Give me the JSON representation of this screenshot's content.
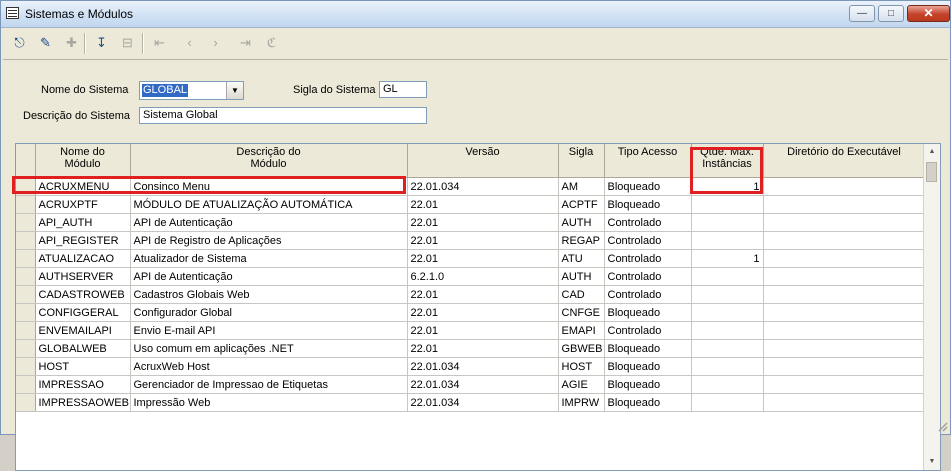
{
  "window": {
    "title": "Sistemas e Módulos"
  },
  "form": {
    "nome_sistema_label": "Nome do Sistema",
    "nome_sistema_value": "GLOBAL",
    "sigla_label": "Sigla do Sistema",
    "sigla_value": "GL",
    "descricao_label": "Descrição do Sistema",
    "descricao_value": "Sistema Global"
  },
  "grid": {
    "headers": [
      "Nome do\nMódulo",
      "Descrição do\nMódulo",
      "Versão",
      "Sigla",
      "Tipo Acesso",
      "Qtde. Máx.\nInstâncias",
      "Diretório do Executável"
    ],
    "rows": [
      [
        "ACRUXMENU",
        "Consinco Menu",
        "22.01.034",
        "AM",
        "Bloqueado",
        "1",
        ""
      ],
      [
        "ACRUXPTF",
        "MÓDULO DE ATUALIZAÇÃO AUTOMÁTICA",
        "22.01",
        "ACPTF",
        "Bloqueado",
        "",
        ""
      ],
      [
        "API_AUTH",
        "API de Autenticação",
        "22.01",
        "AUTH",
        "Controlado",
        "",
        ""
      ],
      [
        "API_REGISTER",
        "API de Registro de Aplicações",
        "22.01",
        "REGAP",
        "Controlado",
        "",
        ""
      ],
      [
        "ATUALIZACAO",
        "Atualizador de Sistema",
        "22.01",
        "ATU",
        "Controlado",
        "1",
        ""
      ],
      [
        "AUTHSERVER",
        "API de Autenticação",
        "6.2.1.0",
        "AUTH",
        "Controlado",
        "",
        ""
      ],
      [
        "CADASTROWEB",
        "Cadastros Globais Web",
        "22.01",
        "CAD",
        "Controlado",
        "",
        ""
      ],
      [
        "CONFIGGERAL",
        "Configurador Global",
        "22.01",
        "CNFGE",
        "Bloqueado",
        "",
        ""
      ],
      [
        "ENVEMAILAPI",
        "Envio E-mail API",
        "22.01",
        "EMAPI",
        "Controlado",
        "",
        ""
      ],
      [
        "GLOBALWEB",
        "Uso comum em aplicações .NET",
        "22.01",
        "GBWEB",
        "Bloqueado",
        "",
        ""
      ],
      [
        "HOST",
        "AcruxWeb Host",
        "22.01.034",
        "HOST",
        "Bloqueado",
        "",
        ""
      ],
      [
        "IMPRESSAO",
        "Gerenciador de Impressao de Etiquetas",
        "22.01.034",
        "AGIE",
        "Bloqueado",
        "",
        ""
      ],
      [
        "IMPRESSAOWEB",
        "Impressão Web",
        "22.01.034",
        "IMPRW",
        "Bloqueado",
        "",
        ""
      ]
    ]
  },
  "colors": {
    "highlight": "#e02020",
    "selection": "#316ac5"
  }
}
